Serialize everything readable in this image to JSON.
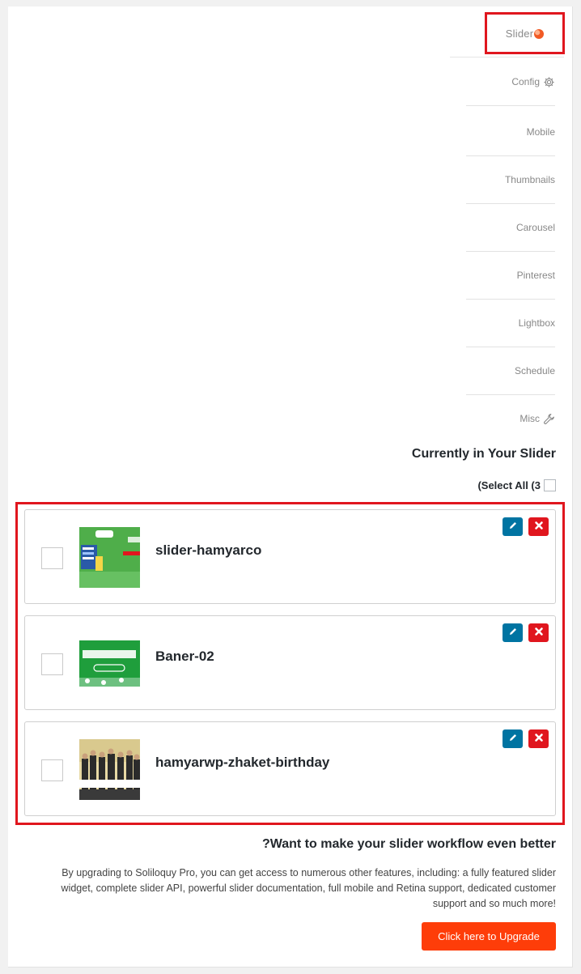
{
  "header": {
    "logo_text": "Slider"
  },
  "tabs": [
    {
      "label": "Config",
      "icon": "gear-icon"
    },
    {
      "label": "Mobile"
    },
    {
      "label": "Thumbnails"
    },
    {
      "label": "Carousel"
    },
    {
      "label": "Pinterest"
    },
    {
      "label": "Lightbox"
    },
    {
      "label": "Schedule"
    },
    {
      "label": "Misc",
      "icon": "wrench-icon"
    }
  ],
  "current": {
    "title": "Currently in Your Slider",
    "select_all": "(Select All (3"
  },
  "slides": [
    {
      "title": "slider-hamyarco"
    },
    {
      "title": "Baner-02"
    },
    {
      "title": "hamyarwp-zhaket-birthday"
    }
  ],
  "upgrade": {
    "title": "?Want to make your slider workflow even better",
    "text": "By upgrading to Soliloquy Pro, you can get access to numerous other features, including: a fully featured slider widget, complete slider API, powerful slider documentation, full mobile and Retina support, dedicated customer support and so much more!",
    "button": "Click here to Upgrade"
  },
  "colors": {
    "accent_red": "#e0161e",
    "edit_blue": "#0074a2",
    "upgrade_orange": "#fe3d09"
  }
}
